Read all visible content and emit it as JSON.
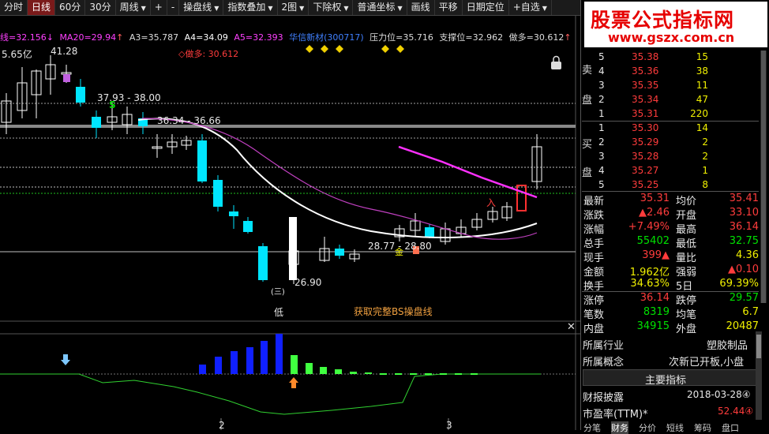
{
  "toolbar": {
    "items": [
      "分时",
      "日线",
      "60分",
      "30分",
      "周线",
      "+",
      "-",
      "操盘线",
      "指数叠加",
      "2图",
      "下除权",
      "普通坐标",
      "画线",
      "平移",
      "日期定位",
      "+自选"
    ]
  },
  "legend": {
    "ma_base": "线=32.156",
    "ma20": "MA20=29.94",
    "a3": "A3=35.787",
    "a4": "A4=34.09",
    "a5": "A5=32.393",
    "stock": "华信新材(300717)",
    "pressure": "压力位=35.716",
    "support": "支撑位=32.962",
    "short": "做多=30.612"
  },
  "chart_labels": {
    "volume_top": "5.65亿",
    "high_mark": "41.28",
    "range1": "37.93 - 38.00",
    "range2": "36.34 - 36.66",
    "short_tag": "◇做多: 30.612",
    "range3": "28.77 - 28.80",
    "low_price": "26.90",
    "low_tag": "低",
    "circle_tag": "(三)",
    "s_tag": "S",
    "in_tag": "入",
    "gold_tag": "金",
    "get_bs": "获取完整BS操盘线",
    "xaxis_2": "2",
    "xaxis_3": "3"
  },
  "logo": {
    "title": "股票公式指标网",
    "url": "www.gszx.com.cn"
  },
  "orderbook": {
    "sell_label": [
      "卖",
      "盘"
    ],
    "buy_label": [
      "买",
      "盘"
    ],
    "sell": [
      {
        "lvl": "5",
        "price": "35.38",
        "vol": "15"
      },
      {
        "lvl": "4",
        "price": "35.36",
        "vol": "38"
      },
      {
        "lvl": "3",
        "price": "35.35",
        "vol": "11"
      },
      {
        "lvl": "2",
        "price": "35.34",
        "vol": "47"
      },
      {
        "lvl": "1",
        "price": "35.31",
        "vol": "220"
      }
    ],
    "buy": [
      {
        "lvl": "1",
        "price": "35.30",
        "vol": "14"
      },
      {
        "lvl": "2",
        "price": "35.29",
        "vol": "2"
      },
      {
        "lvl": "3",
        "price": "35.28",
        "vol": "2"
      },
      {
        "lvl": "4",
        "price": "35.27",
        "vol": "1"
      },
      {
        "lvl": "5",
        "price": "35.25",
        "vol": "8"
      }
    ]
  },
  "stats": [
    {
      "l1": "最新",
      "v1": "35.31",
      "l2": "均价",
      "v2": "35.41"
    },
    {
      "l1": "涨跌",
      "v1": "▲2.46",
      "l2": "开盘",
      "v2": "33.10"
    },
    {
      "l1": "涨幅",
      "v1": "+7.49%",
      "l2": "最高",
      "v2": "36.14"
    },
    {
      "l1": "总手",
      "v1": "55402",
      "l2": "最低",
      "v2": "32.75"
    },
    {
      "l1": "现手",
      "v1": "399▲",
      "l2": "量比",
      "v2": "4.36"
    },
    {
      "l1": "金额",
      "v1": "1.962亿",
      "l2": "强弱",
      "v2": "▲0.10"
    },
    {
      "l1": "换手",
      "v1": "34.63%",
      "l2": "5日",
      "v2": "69.39%"
    },
    {
      "l1": "涨停",
      "v1": "36.14",
      "l2": "跌停",
      "v2": "29.57"
    },
    {
      "l1": "笔数",
      "v1": "8319",
      "l2": "均笔",
      "v2": "6.7"
    },
    {
      "l1": "内盘",
      "v1": "34915",
      "l2": "外盘",
      "v2": "20487"
    }
  ],
  "info": {
    "industry_label": "所属行业",
    "industry": "塑胶制品",
    "concept_label": "所属概念",
    "concept": "次新已开板,小盘",
    "main_index": "主要指标",
    "report_label": "财报披露",
    "report_date": "2018-03-28④",
    "pe_label": "市盈率(TTM)*",
    "pe": "52.44④"
  },
  "tabs": [
    "分笔",
    "财务",
    "分价",
    "短线",
    "筹码",
    "盘口"
  ],
  "colors": {
    "up": "#ff3c3c",
    "down": "#00e5ff",
    "ma_white": "#ffffff",
    "ma_purple": "#c040c0",
    "ma_magenta": "#ff30ff",
    "grid": "#a0a0a0"
  }
}
